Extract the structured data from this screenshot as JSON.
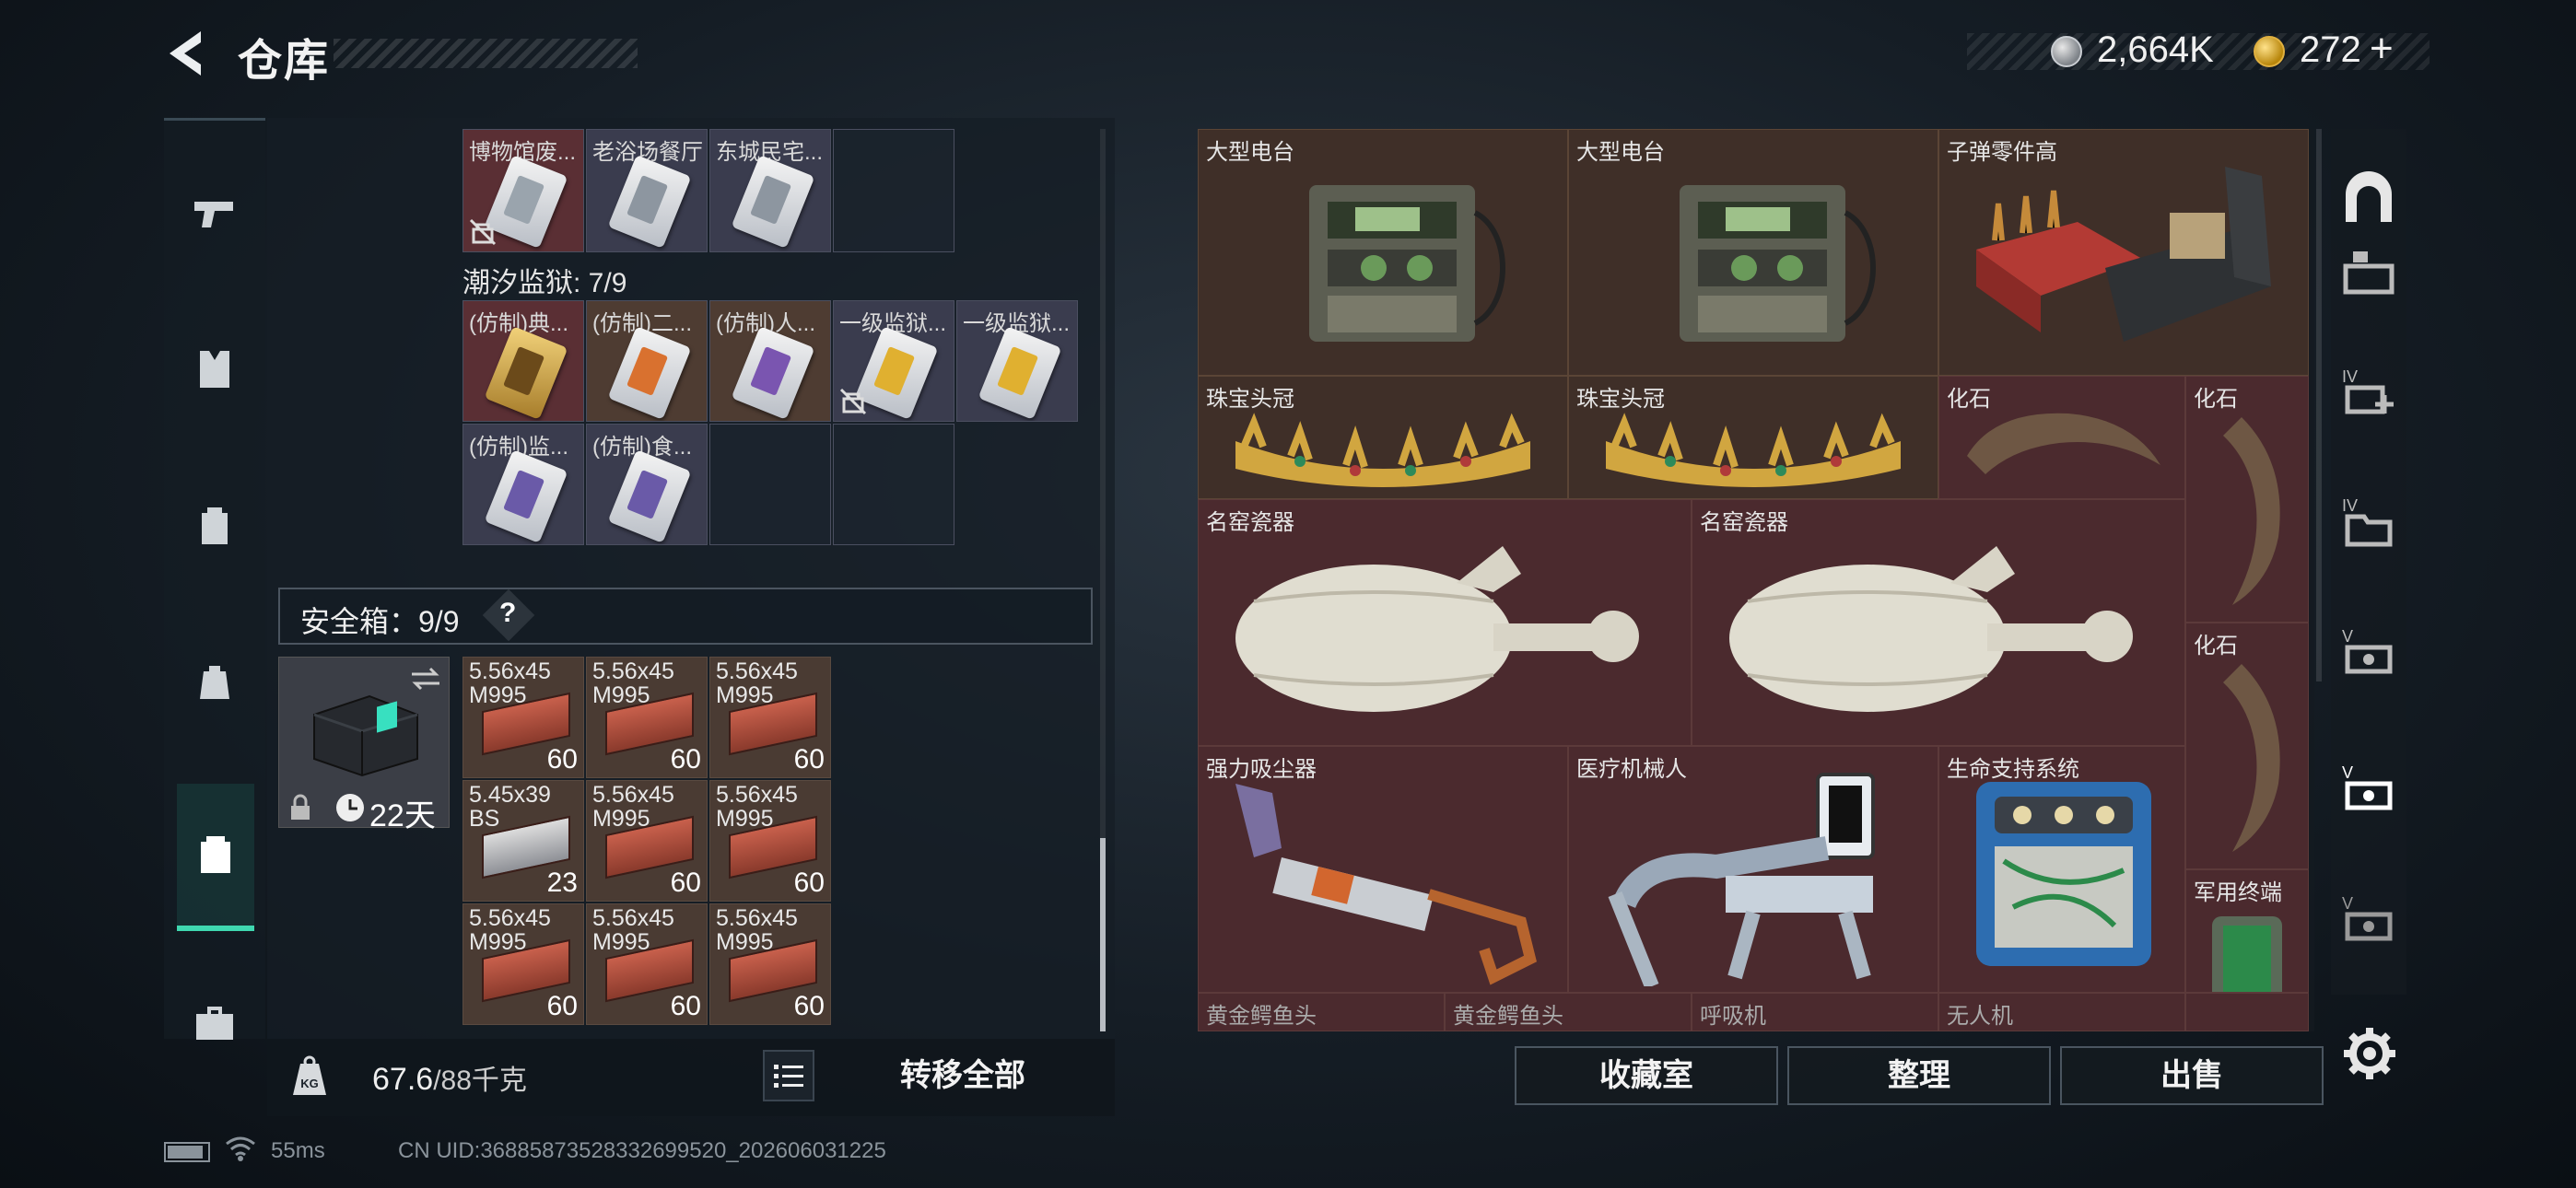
{
  "header": {
    "title": "仓库",
    "currency_1": "2,664K",
    "currency_2": "272",
    "add_symbol": "+"
  },
  "colors": {
    "accent": "#3fd8b0",
    "item_red": "#5a2f34",
    "item_purple": "#3a3c4e",
    "item_brown": "#4e3c32"
  },
  "left_tabs": [
    {
      "icon": "pistol-icon"
    },
    {
      "icon": "armor-vest-icon"
    },
    {
      "icon": "backpack-icon"
    },
    {
      "icon": "bag-icon"
    },
    {
      "icon": "safe-case-icon",
      "active": true
    },
    {
      "icon": "toolbox-icon"
    }
  ],
  "keycards_top": [
    "博物馆废...",
    "老浴场餐厅",
    "东城民宅..."
  ],
  "prison": {
    "label": "潮汐监狱: 7/9",
    "cards_row1": [
      "(仿制)典...",
      "(仿制)二...",
      "(仿制)人...",
      "一级监狱...",
      "一级监狱..."
    ],
    "cards_row2": [
      "(仿制)监...",
      "(仿制)食..."
    ]
  },
  "safebox": {
    "label": "安全箱：9/9",
    "help": "?",
    "duration": "22天",
    "ammo": [
      {
        "line1": "5.56x45",
        "line2": "M995",
        "count": "60",
        "type": "red"
      },
      {
        "line1": "5.56x45",
        "line2": "M995",
        "count": "60",
        "type": "red"
      },
      {
        "line1": "5.56x45",
        "line2": "M995",
        "count": "60",
        "type": "red"
      },
      {
        "line1": "5.45x39",
        "line2": "BS",
        "count": "23",
        "type": "silver"
      },
      {
        "line1": "5.56x45",
        "line2": "M995",
        "count": "60",
        "type": "red"
      },
      {
        "line1": "5.56x45",
        "line2": "M995",
        "count": "60",
        "type": "red"
      },
      {
        "line1": "5.56x45",
        "line2": "M995",
        "count": "60",
        "type": "red"
      },
      {
        "line1": "5.56x45",
        "line2": "M995",
        "count": "60",
        "type": "red"
      },
      {
        "line1": "5.56x45",
        "line2": "M995",
        "count": "60",
        "type": "red"
      }
    ]
  },
  "bottom_left": {
    "weight": "67.6",
    "weight_max": "/88千克",
    "transfer_all": "转移全部"
  },
  "stash": {
    "items": {
      "radio1": "大型电台",
      "radio2": "大型电台",
      "ammo_parts": "子弹零件高",
      "crown1": "珠宝头冠",
      "crown2": "珠宝头冠",
      "fossil1": "化石",
      "fossil2": "化石",
      "fossil3": "化石",
      "vase1": "名窑瓷器",
      "vase2": "名窑瓷器",
      "vacuum": "强力吸尘器",
      "robot": "医疗机械人",
      "life_support": "生命支持系统",
      "terminal": "军用终端",
      "croc1": "黄金鳄鱼头",
      "croc2": "黄金鳄鱼头",
      "ventilator": "呼吸机",
      "drone": "无人机"
    },
    "buttons": {
      "collection": "收藏室",
      "sort": "整理",
      "sell": "出售"
    }
  },
  "right_tabs": [
    {
      "icon": "vault-icon"
    },
    {
      "icon": "storage-tab-1-icon"
    },
    {
      "icon": "storage-tab-4-add-icon"
    },
    {
      "icon": "storage-tab-4-folder-icon"
    },
    {
      "icon": "storage-tab-5-icon"
    },
    {
      "icon": "storage-tab-5-active-icon"
    },
    {
      "icon": "storage-tab-5-alt-icon"
    }
  ],
  "status": {
    "ping": "55ms",
    "uid": "CN UID:36885873528332699520_202606031225"
  }
}
